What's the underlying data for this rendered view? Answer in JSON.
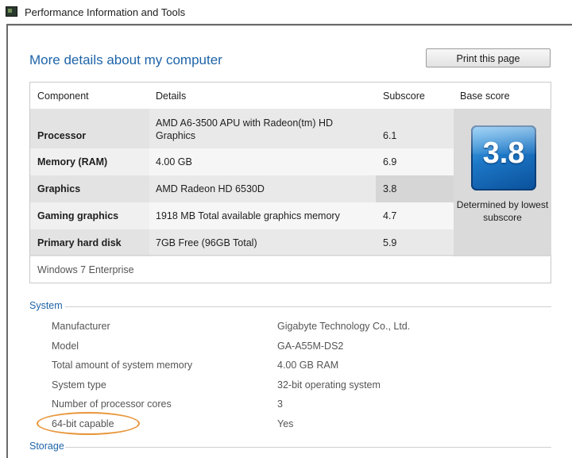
{
  "window": {
    "title": "Performance Information and Tools"
  },
  "page": {
    "heading": "More details about my computer",
    "print_label": "Print this page"
  },
  "score_table": {
    "headers": [
      "Component",
      "Details",
      "Subscore",
      "Base score"
    ],
    "rows": [
      {
        "component": "Processor",
        "details": "AMD A6-3500 APU with Radeon(tm) HD Graphics",
        "subscore": "6.1"
      },
      {
        "component": "Memory (RAM)",
        "details": "4.00 GB",
        "subscore": "6.9"
      },
      {
        "component": "Graphics",
        "details": "AMD Radeon HD 6530D",
        "subscore": "3.8"
      },
      {
        "component": "Gaming graphics",
        "details": "1918 MB Total available graphics memory",
        "subscore": "4.7"
      },
      {
        "component": "Primary hard disk",
        "details": "7GB Free (96GB Total)",
        "subscore": "5.9"
      }
    ],
    "base_score": "3.8",
    "base_caption": "Determined by lowest subscore",
    "os": "Windows 7 Enterprise"
  },
  "system": {
    "title": "System",
    "items": [
      {
        "label": "Manufacturer",
        "value": "Gigabyte Technology Co., Ltd."
      },
      {
        "label": "Model",
        "value": "GA-A55M-DS2"
      },
      {
        "label": "Total amount of system memory",
        "value": "4.00 GB RAM"
      },
      {
        "label": "System type",
        "value": "32-bit operating system"
      },
      {
        "label": "Number of processor cores",
        "value": "3"
      },
      {
        "label": "64-bit capable",
        "value": "Yes"
      }
    ]
  },
  "storage": {
    "title": "Storage"
  },
  "colors": {
    "link_blue": "#1e64a8",
    "row_shaded": "#e9e9e9",
    "base_panel": "#dadada",
    "highlight_orange": "#e8953a"
  },
  "icons": {
    "window_icon": "performance-tool-icon",
    "score_badge": "windows-experience-badge"
  }
}
